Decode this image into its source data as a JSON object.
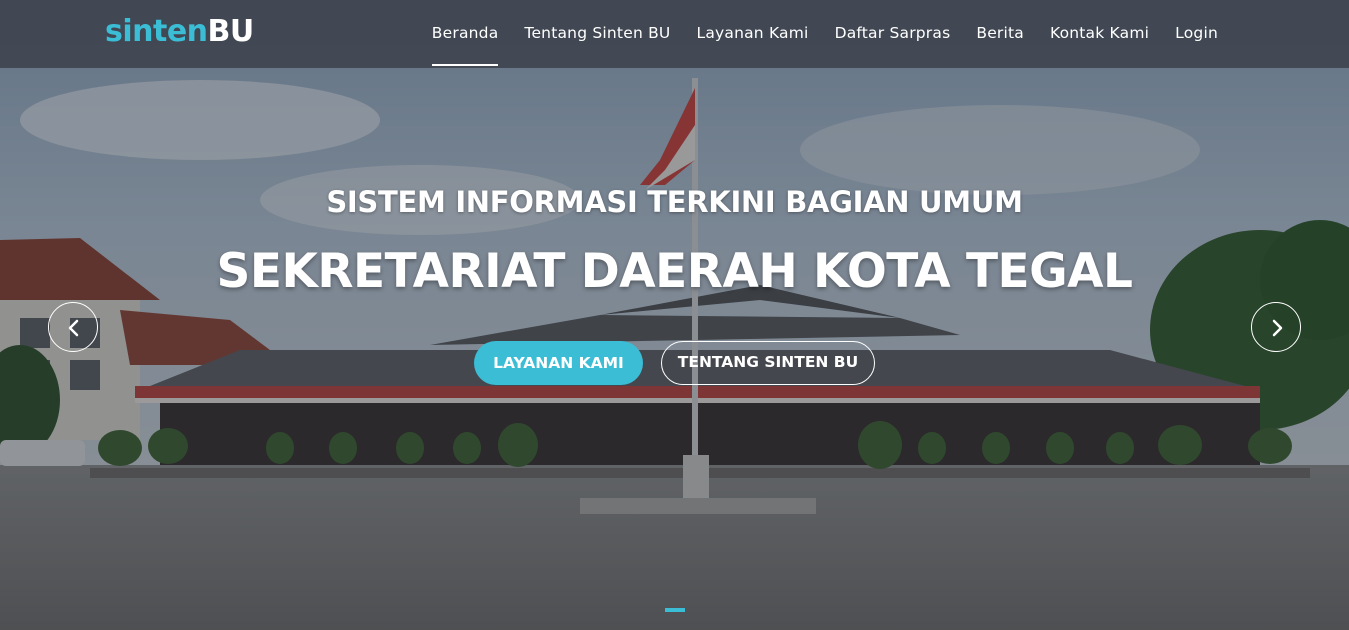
{
  "brand": {
    "part1": "sinten",
    "part2": "BU",
    "accent": "#3bbdd6"
  },
  "nav": {
    "items": [
      {
        "label": "Beranda",
        "active": true
      },
      {
        "label": "Tentang Sinten BU",
        "active": false
      },
      {
        "label": "Layanan Kami",
        "active": false
      },
      {
        "label": "Daftar Sarpras",
        "active": false
      },
      {
        "label": "Berita",
        "active": false
      },
      {
        "label": "Kontak Kami",
        "active": false
      },
      {
        "label": "Login",
        "active": false
      }
    ]
  },
  "hero": {
    "subtitle": "SISTEM INFORMASI TERKINI BAGIAN UMUM",
    "title": "SEKRETARIAT DAERAH KOTA TEGAL",
    "primary_button": "LAYANAN KAMI",
    "secondary_button": "TENTANG SINTEN BU",
    "prev_icon": "chevron-left-icon",
    "next_icon": "chevron-right-icon",
    "slides_indicated": 1,
    "active_slide": 1
  },
  "colors": {
    "accent": "#3bbdd6",
    "navbar": "#3c424c"
  }
}
